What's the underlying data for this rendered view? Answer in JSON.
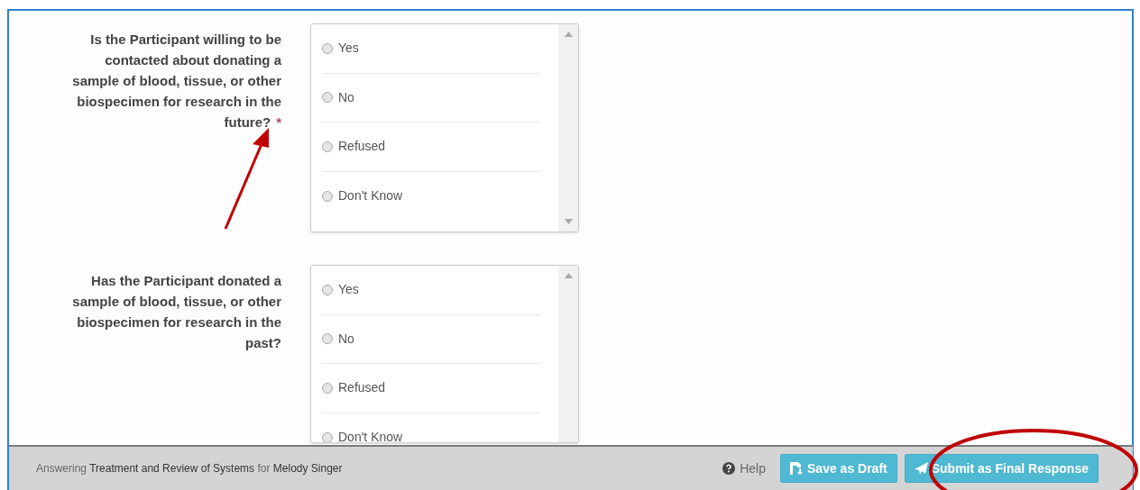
{
  "questions": [
    {
      "text": "Is the Participant willing to be contacted about donating a sample of blood, tissue, or other biospecimen for research in the future?",
      "required": true,
      "required_mark": "*",
      "options": [
        {
          "label": "Yes",
          "selected": false
        },
        {
          "label": "No",
          "selected": false
        },
        {
          "label": "Refused",
          "selected": false
        },
        {
          "label": "Don't Know",
          "selected": false
        }
      ]
    },
    {
      "text": "Has the Participant donated a sample of blood, tissue, or other biospecimen for research in the past?",
      "required": false,
      "options": [
        {
          "label": "Yes",
          "selected": false
        },
        {
          "label": "No",
          "selected": false
        },
        {
          "label": "Refused",
          "selected": false
        },
        {
          "label": "Don't Know",
          "selected": false
        }
      ]
    }
  ],
  "footer": {
    "context": "Answering **Treatment and Review of Systems** for **Melody Singer**",
    "help": "Help",
    "buttons": [
      {
        "kind": "draft",
        "label": "Save as Draft"
      },
      {
        "kind": "submit",
        "label": "Submit as Final Response"
      }
    ]
  }
}
